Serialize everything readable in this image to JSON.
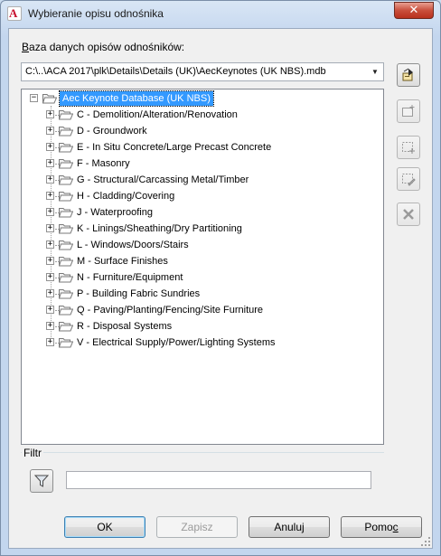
{
  "window": {
    "title": "Wybieranie opisu odnośnika",
    "close_label": "✕"
  },
  "database": {
    "label_accel": "B",
    "label_rest": "aza danych opisów odnośników:",
    "selected": "C:\\..\\ACA 2017\\plk\\Details\\Details (UK)\\AecKeynotes (UK NBS).mdb"
  },
  "tree": {
    "root": {
      "label": "Aec Keynote Database (UK NBS)",
      "expander": "−"
    },
    "items": [
      {
        "label": "C - Demolition/Alteration/Renovation",
        "expander": "+"
      },
      {
        "label": "D - Groundwork",
        "expander": "+"
      },
      {
        "label": "E - In Situ Concrete/Large Precast Concrete",
        "expander": "+"
      },
      {
        "label": "F - Masonry",
        "expander": "+"
      },
      {
        "label": "G - Structural/Carcassing Metal/Timber",
        "expander": "+"
      },
      {
        "label": "H - Cladding/Covering",
        "expander": "+"
      },
      {
        "label": "J - Waterproofing",
        "expander": "+"
      },
      {
        "label": "K - Linings/Sheathing/Dry Partitioning",
        "expander": "+"
      },
      {
        "label": "L - Windows/Doors/Stairs",
        "expander": "+"
      },
      {
        "label": "M - Surface Finishes",
        "expander": "+"
      },
      {
        "label": "N - Furniture/Equipment",
        "expander": "+"
      },
      {
        "label": "P - Building Fabric Sundries",
        "expander": "+"
      },
      {
        "label": "Q - Paving/Planting/Fencing/Site Furniture",
        "expander": "+"
      },
      {
        "label": "R - Disposal Systems",
        "expander": "+"
      },
      {
        "label": "V - Electrical Supply/Power/Lighting Systems",
        "expander": "+"
      }
    ]
  },
  "side_toolbar": [
    {
      "icon": "open-database-icon",
      "enabled": true
    },
    {
      "icon": "new-group-icon",
      "enabled": false
    },
    {
      "icon": "new-keynote-icon",
      "enabled": false
    },
    {
      "icon": "edit-keynote-icon",
      "enabled": false
    },
    {
      "icon": "delete-icon",
      "enabled": false
    }
  ],
  "filter": {
    "title": "Filtr",
    "value": "",
    "icon": "funnel-icon"
  },
  "buttons": {
    "ok": "OK",
    "zapisz": "Zapisz",
    "anuluj": "Anuluj",
    "pomoc_pre": "Pomo",
    "pomoc_accel": "c"
  },
  "colors": {
    "selection": "#3399ff",
    "close": "#c94f3c"
  }
}
